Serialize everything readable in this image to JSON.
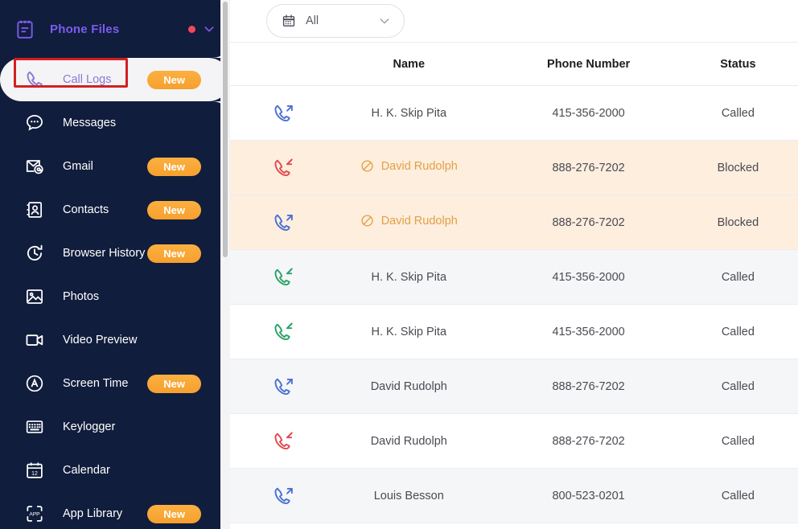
{
  "sidebar": {
    "header": {
      "title": "Phone Files",
      "icon": "clipboard-icon",
      "status_dot_color": "#f2485b",
      "chevron": "chevron-down-icon"
    },
    "items": [
      {
        "label": "Call Logs",
        "icon": "phone-icon",
        "badge": "New",
        "active": true
      },
      {
        "label": "Messages",
        "icon": "chat-bubble-icon",
        "badge": "",
        "active": false
      },
      {
        "label": "Gmail",
        "icon": "envelope-at-icon",
        "badge": "New",
        "active": false
      },
      {
        "label": "Contacts",
        "icon": "contact-card-icon",
        "badge": "New",
        "active": false
      },
      {
        "label": "Browser History",
        "icon": "clock-history-icon",
        "badge": "New",
        "active": false
      },
      {
        "label": "Photos",
        "icon": "image-icon",
        "badge": "",
        "active": false
      },
      {
        "label": "Video Preview",
        "icon": "video-camera-icon",
        "badge": "",
        "active": false
      },
      {
        "label": "Screen Time",
        "icon": "screen-time-a-icon",
        "badge": "New",
        "active": false
      },
      {
        "label": "Keylogger",
        "icon": "keyboard-icon",
        "badge": "",
        "active": false
      },
      {
        "label": "Calendar",
        "icon": "calendar-12-icon",
        "badge": "",
        "active": false
      },
      {
        "label": "App Library",
        "icon": "app-library-icon",
        "badge": "New",
        "active": false
      }
    ]
  },
  "toolbar": {
    "date_filter": {
      "icon": "calendar-icon",
      "value": "All",
      "chevron": "chevron-down-icon"
    }
  },
  "table": {
    "headers": {
      "icon": "",
      "name": "Name",
      "phone": "Phone Number",
      "status": "Status"
    },
    "rows": [
      {
        "direction": "outgoing",
        "icon": "phone-outgoing-icon",
        "icon_color": "#4a6fd4",
        "name": "H. K. Skip Pita",
        "phone": "415-356-2000",
        "status": "Called",
        "blocked": false,
        "row_style": "row-white"
      },
      {
        "direction": "incoming",
        "icon": "phone-incoming-icon",
        "icon_color": "#e2484f",
        "name": "David Rudolph",
        "phone": "888-276-7202",
        "status": "Blocked",
        "blocked": true,
        "row_style": "row-block"
      },
      {
        "direction": "outgoing",
        "icon": "phone-outgoing-icon",
        "icon_color": "#4a6fd4",
        "name": "David Rudolph",
        "phone": "888-276-7202",
        "status": "Blocked",
        "blocked": true,
        "row_style": "row-block"
      },
      {
        "direction": "incoming",
        "icon": "phone-incoming-icon",
        "icon_color": "#27a366",
        "name": "H. K. Skip Pita",
        "phone": "415-356-2000",
        "status": "Called",
        "blocked": false,
        "row_style": "row-gray"
      },
      {
        "direction": "incoming",
        "icon": "phone-incoming-icon",
        "icon_color": "#27a366",
        "name": "H. K. Skip Pita",
        "phone": "415-356-2000",
        "status": "Called",
        "blocked": false,
        "row_style": "row-white"
      },
      {
        "direction": "outgoing",
        "icon": "phone-outgoing-icon",
        "icon_color": "#4a6fd4",
        "name": "David Rudolph",
        "phone": "888-276-7202",
        "status": "Called",
        "blocked": false,
        "row_style": "row-gray"
      },
      {
        "direction": "incoming",
        "icon": "phone-incoming-icon",
        "icon_color": "#e2484f",
        "name": "David Rudolph",
        "phone": "888-276-7202",
        "status": "Called",
        "blocked": false,
        "row_style": "row-white"
      },
      {
        "direction": "outgoing",
        "icon": "phone-outgoing-icon",
        "icon_color": "#4a6fd4",
        "name": "Louis Besson",
        "phone": "800-523-0201",
        "status": "Called",
        "blocked": false,
        "row_style": "row-gray"
      }
    ]
  },
  "colors": {
    "sidebar_bg": "#111d3c",
    "brand_purple": "#7c5cf0",
    "badge_orange": "#f6a02e",
    "blocked_row_bg": "#fdeede",
    "blocked_text": "#e2a045",
    "annotation_red": "#d32020"
  }
}
